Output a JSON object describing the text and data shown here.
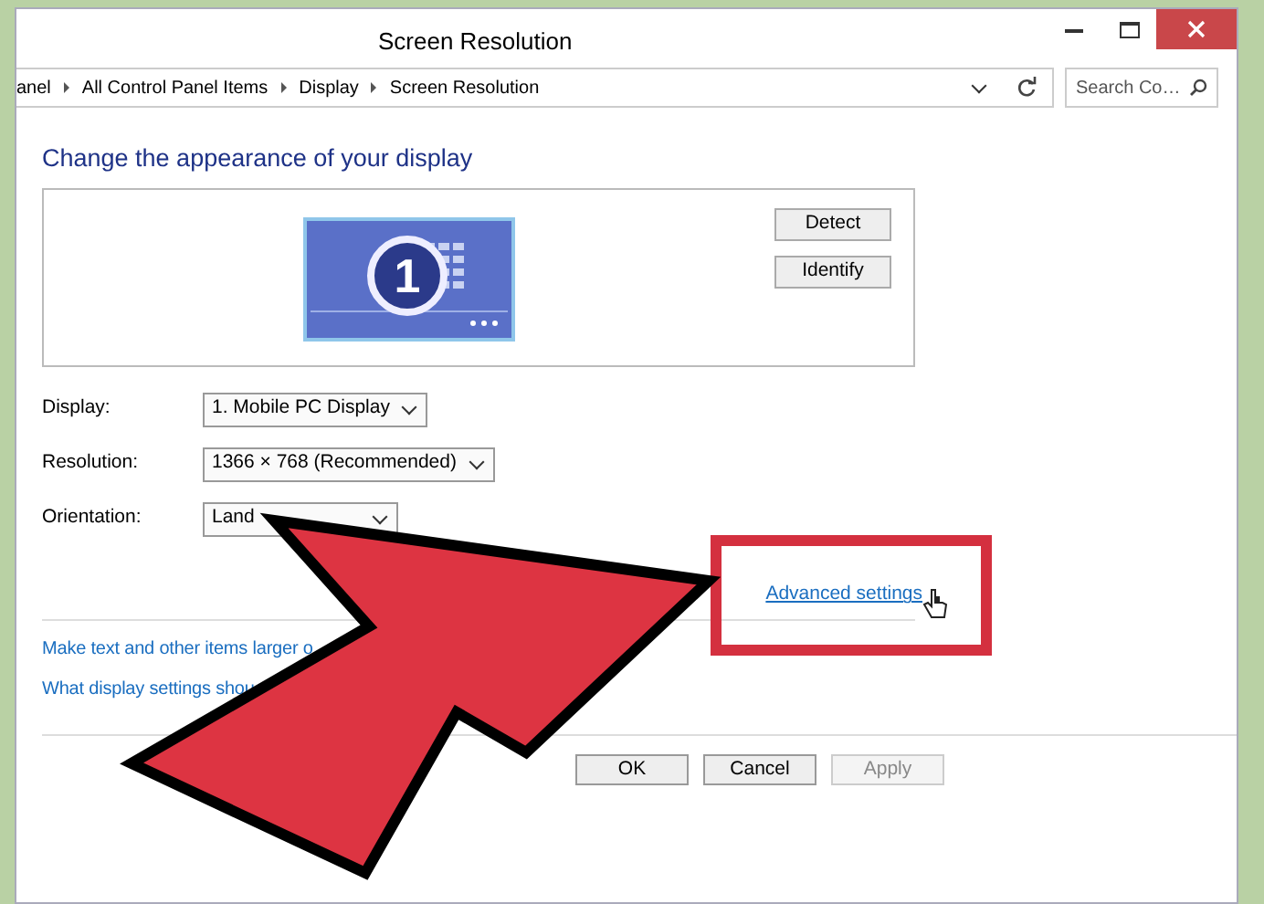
{
  "window": {
    "title": "Screen Resolution"
  },
  "address_bar": {
    "breadcrumb": [
      "anel",
      "All Control Panel Items",
      "Display",
      "Screen Resolution"
    ]
  },
  "search": {
    "placeholder": "Search Co…"
  },
  "heading": "Change the appearance of your display",
  "monitor": {
    "number": "1"
  },
  "side_buttons": [
    "Detect",
    "Identify"
  ],
  "settings": [
    {
      "label": "Display:",
      "value": "1. Mobile PC Display"
    },
    {
      "label": "Resolution:",
      "value": "1366 × 768 (Recommended)"
    },
    {
      "label": "Orientation:",
      "value": "Land"
    }
  ],
  "advanced_link": {
    "label": "Advanced settings",
    "highlighted": true
  },
  "links": [
    "Make text and other items larger o",
    "What display settings shou"
  ],
  "buttons": [
    {
      "label": "OK",
      "disabled": false
    },
    {
      "label": "Cancel",
      "disabled": false
    },
    {
      "label": "Apply",
      "disabled": true
    }
  ]
}
